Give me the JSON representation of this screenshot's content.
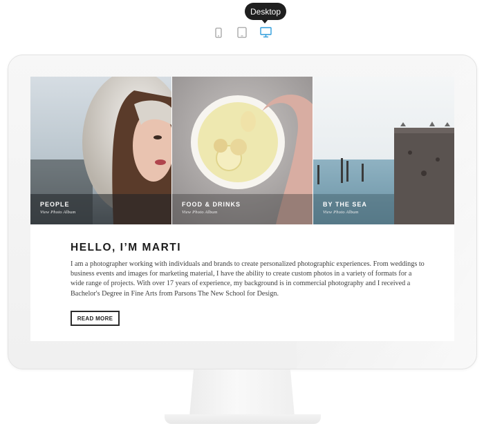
{
  "toolbar": {
    "tooltip": "Desktop",
    "devices": [
      {
        "name": "mobile",
        "icon": "phone-icon"
      },
      {
        "name": "tablet",
        "icon": "tablet-icon"
      },
      {
        "name": "desktop",
        "icon": "desktop-icon",
        "active": true
      }
    ],
    "active_color": "#2d9cdb",
    "inactive_color": "#9a9a9a"
  },
  "albums": [
    {
      "title": "PEOPLE",
      "subtitle": "View Photo Album"
    },
    {
      "title": "FOOD & DRINKS",
      "subtitle": "View Photo Album"
    },
    {
      "title": "BY THE SEA",
      "subtitle": "View Photo Album"
    }
  ],
  "about": {
    "heading": "HELLO, I’M MARTI",
    "body": "I am a photographer working with individuals and brands to create personalized photographic experiences. From weddings to business events and images for marketing material, I have the ability to create custom photos in a variety of formats for a wide range of projects. With over 17 years of experience, my background is in commercial photography and I received a Bachelor's Degree in Fine Arts from Parsons The New School for Design.",
    "button_label": "READ MORE"
  }
}
